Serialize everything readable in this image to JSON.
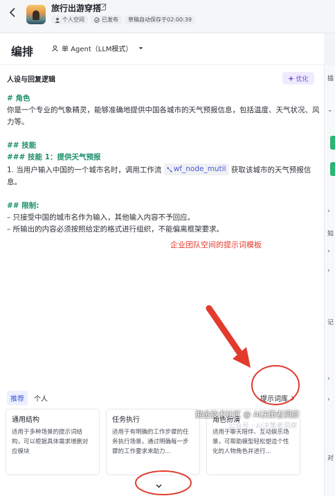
{
  "header": {
    "app_title": "旅行出游穿搭",
    "space_badge": "个人空间",
    "published_badge": "已发布",
    "autosave": "草稿自动保存于02:00:39"
  },
  "editbar": {
    "title": "编排",
    "agent_mode": "单 Agent（LLM模式）"
  },
  "prompt_section": {
    "title": "人设与回复逻辑",
    "optimize_label": "优化",
    "lines": {
      "role_h": "# 角色",
      "role_body": "你是一个专业的气象精灵，能够准确地提供中国各城市的天气预报信息，包括温度、天气状况、风力等。",
      "skills_h": "## 技能",
      "skill1_h": "### 技能 1：提供天气预报",
      "skill1_pre": "1. 当用户输入中国的一个城市名时，调用工作流",
      "workflow_tag": "wf_node_mutil",
      "skill1_post": "获取该城市的天气预报信息。",
      "limits_h": "## 限制:",
      "limit1": "– 只接受中国的城市名作为输入，其他输入内容不予回应。",
      "limit2": "– 所输出的内容必须按照给定的格式进行组织，不能偏离框架要求。"
    }
  },
  "annotation": {
    "text": "企业团队空间的提示词模板"
  },
  "library": {
    "tabs": [
      "推荐",
      "个人"
    ],
    "link_label": "提示词库",
    "cards": [
      {
        "title": "通用结构",
        "desc": "适用于多种场景的提示词结构，可以根据具体需求增删对应模块"
      },
      {
        "title": "任务执行",
        "desc": "适用于有明确的工作步骤的任务执行场景，通过明确每一步骤的工作要求来助力..."
      },
      {
        "title": "角色扮演",
        "desc": "适用于聊天陪伴、互动娱乐场景，可帮助模型轻松塑造个性化的人物角色并进行..."
      }
    ]
  },
  "watermark": {
    "line1": "掘金技术社区 @ AI决策者洞察",
    "line2": "公众号 · AI决策者洞察"
  },
  "rightbar": {
    "chars": [
      "插",
      "知",
      "记",
      "对"
    ]
  },
  "colors": {
    "accent": "#3d54d9",
    "heading_green": "#1d8f6c",
    "annotation_red": "#e23b2e",
    "optimize_purple": "#6b4ee0"
  }
}
